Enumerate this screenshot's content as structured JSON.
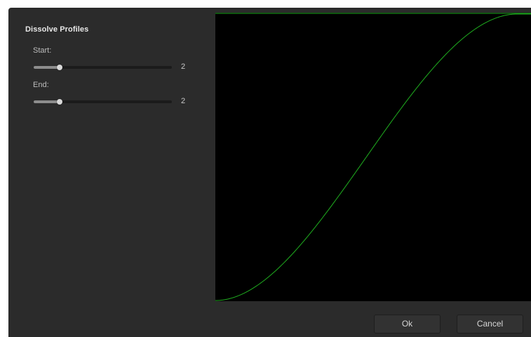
{
  "dialog": {
    "title": "Dissolve Profiles",
    "start": {
      "label": "Start:",
      "value": "2",
      "level": 0.19
    },
    "end": {
      "label": "End:",
      "value": "2",
      "level": 0.19
    }
  },
  "plot": {
    "curve_color": "#1fae1f",
    "background_color": "#000000"
  },
  "buttons": {
    "ok_label": "Ok",
    "cancel_label": "Cancel"
  }
}
